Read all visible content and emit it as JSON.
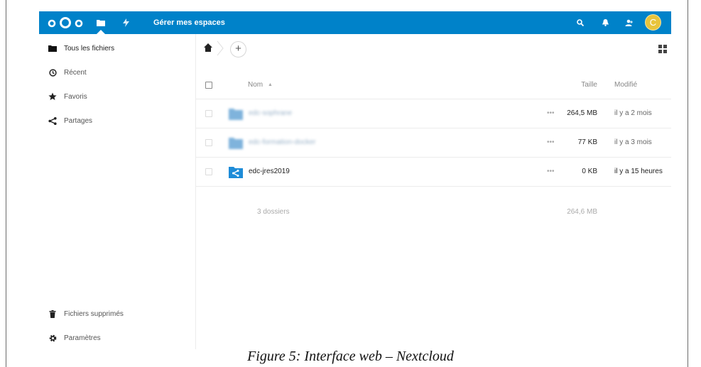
{
  "header": {
    "app_name": "Gérer mes espaces",
    "avatar_letter": "C",
    "accent_color": "#0082c9",
    "icons": [
      "nextcloud-logo",
      "files-icon",
      "activity-icon",
      "search-icon",
      "bell-icon",
      "contacts-icon"
    ]
  },
  "sidebar": {
    "items": [
      {
        "label": "Tous les fichiers",
        "icon": "folder-icon"
      },
      {
        "label": "Récent",
        "icon": "clock-icon"
      },
      {
        "label": "Favoris",
        "icon": "star-icon"
      },
      {
        "label": "Partages",
        "icon": "share-icon"
      }
    ],
    "bottom": [
      {
        "label": "Fichiers supprimés",
        "icon": "trash-icon"
      },
      {
        "label": "Paramètres",
        "icon": "gear-icon"
      }
    ]
  },
  "main": {
    "add_label": "+",
    "columns": {
      "name": "Nom",
      "size": "Taille",
      "modified": "Modifié"
    },
    "files": [
      {
        "name": "edc-sophrane",
        "size": "264,5 MB",
        "modified": "il y a 2 mois",
        "type": "folder"
      },
      {
        "name": "edc-formation-docker",
        "size": "77 KB",
        "modified": "il y a 3 mois",
        "type": "folder"
      },
      {
        "name": "edc-jres2019",
        "size": "0 KB",
        "modified": "il y a 15 heures",
        "type": "shared-folder"
      }
    ],
    "summary": {
      "count": "3 dossiers",
      "total_size": "264,6 MB"
    },
    "actions_label": "•••"
  },
  "caption": "Figure 5: Interface web – Nextcloud"
}
